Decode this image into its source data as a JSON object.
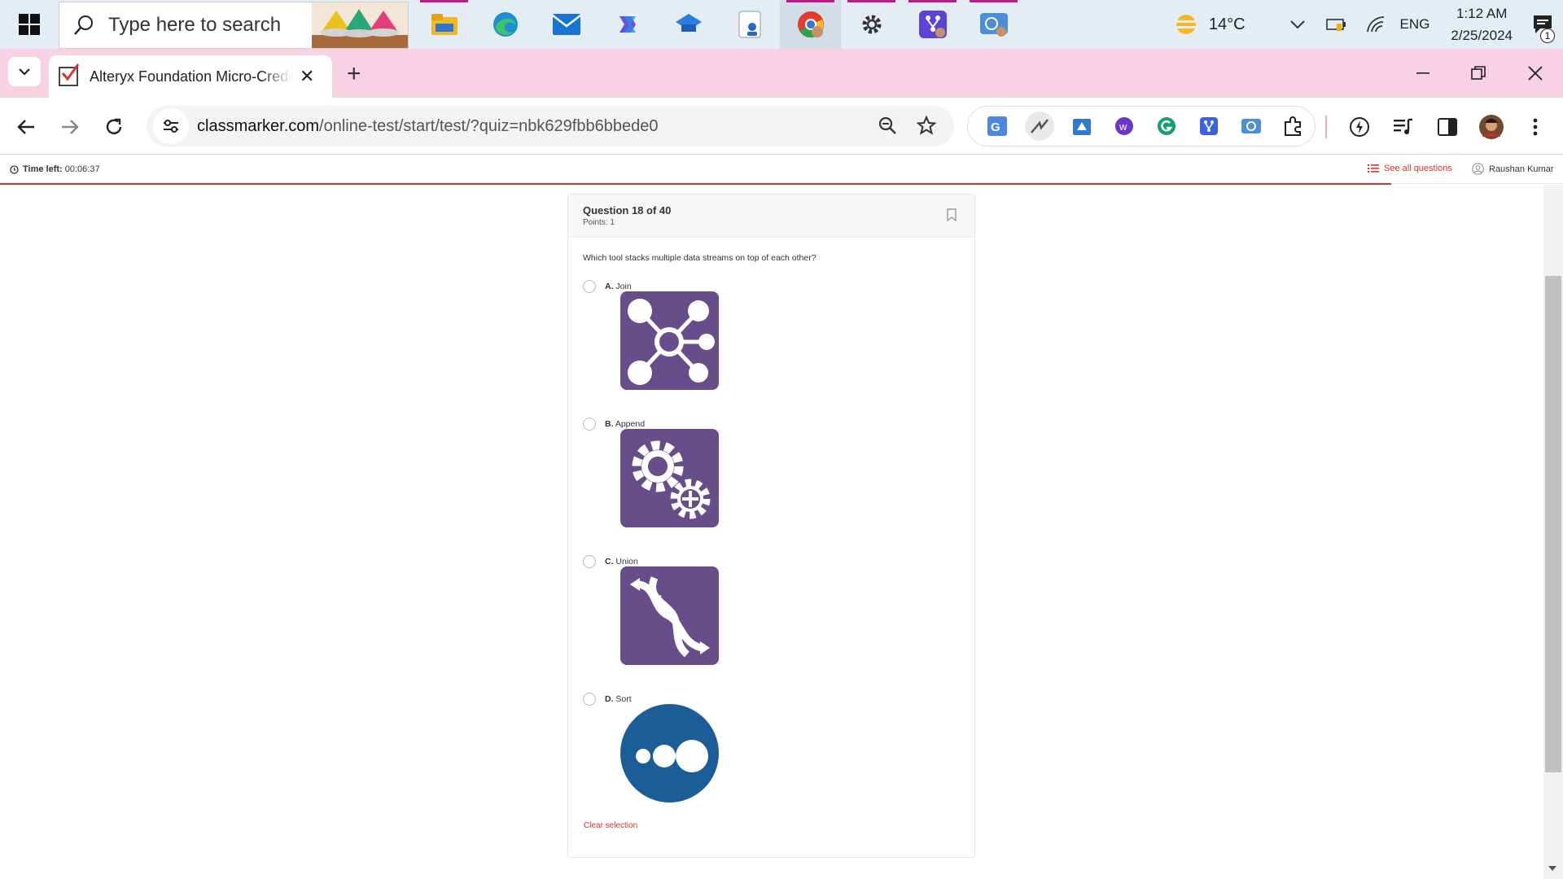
{
  "taskbar": {
    "search_placeholder": "Type here to search",
    "apps": [
      "file-explorer-icon",
      "edge-icon",
      "mail-icon",
      "copilot-icon",
      "teams-icon",
      "user-app-icon",
      "chrome-icon",
      "settings-icon",
      "git-app-icon",
      "web-app-icon"
    ],
    "weather_temp": "14°C",
    "language": "ENG",
    "time": "1:12 AM",
    "date": "2/25/2024",
    "notification_count": "1"
  },
  "browser": {
    "tab_title": "Alteryx Foundation Micro-Credential",
    "url_domain": "classmarker.com",
    "url_path": "/online-test/start/test/?quiz=nbk629fbb6bbede0"
  },
  "quiz": {
    "time_left_label": "Time left:",
    "time_left_value": "00:06:37",
    "see_all_label": "See all questions",
    "user_name": "Raushan Kumar",
    "progress_percent": 89,
    "question_number": "Question 18 of 40",
    "points": "Points: 1",
    "question_text": "Which tool stacks multiple data streams on top of each other?",
    "options": [
      {
        "letter": "A.",
        "text": "Join",
        "icon": "join-network-icon"
      },
      {
        "letter": "B.",
        "text": "Append",
        "icon": "append-gears-icon"
      },
      {
        "letter": "C.",
        "text": "Union",
        "icon": "union-dna-icon"
      },
      {
        "letter": "D.",
        "text": "Sort",
        "icon": "sort-dots-icon"
      }
    ],
    "clear_selection": "Clear selection"
  },
  "colors": {
    "accent_red": "#d9312b",
    "tool_purple": "#674d8a",
    "tool_blue": "#1b5d96",
    "tab_strip_pink": "#f6d2e3"
  }
}
